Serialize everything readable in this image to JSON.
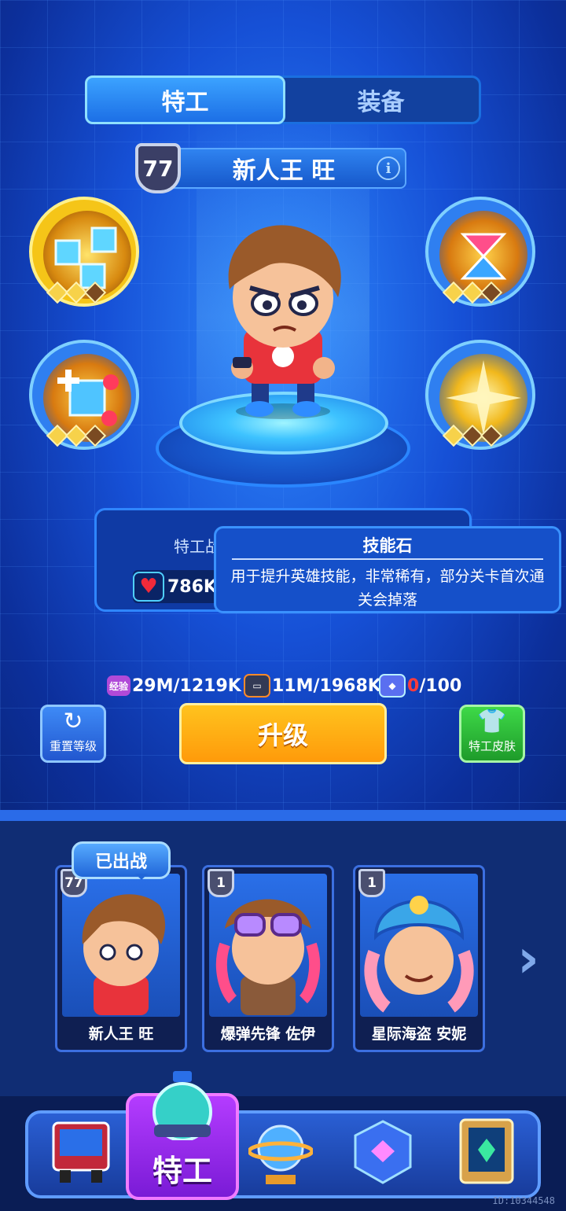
{
  "tabs": {
    "agent": "特工",
    "equipment": "装备"
  },
  "hero": {
    "level": "77",
    "name": "新人王 旺"
  },
  "stats": {
    "label": "特工战",
    "hp": "786K"
  },
  "tooltip": {
    "title": "技能石",
    "description": "用于提升英雄技能，非常稀有，部分关卡首次通关会掉落"
  },
  "resources": {
    "exp": {
      "icon_text": "经验",
      "value": "29M/1219K"
    },
    "tape": {
      "value": "11M/1968K"
    },
    "skill_stone": {
      "current": "0",
      "max": "/100"
    }
  },
  "buttons": {
    "reset": "重置等级",
    "upgrade": "升级",
    "skin": "特工皮肤"
  },
  "roster": {
    "deployed_label": "已出战",
    "cards": [
      {
        "level": "77",
        "name": "新人王 旺"
      },
      {
        "level": "1",
        "name": "爆弹先锋 佐伊"
      },
      {
        "level": "1",
        "name": "星际海盗 安妮"
      }
    ]
  },
  "nav": {
    "active_label": "特工"
  },
  "footer": {
    "id": "ID:10344548"
  },
  "colors": {
    "accent": "#1c6fe6",
    "upgrade": "#ff9a0a",
    "skin": "#1e9b2a",
    "nav_active": "#7a1bd6"
  }
}
